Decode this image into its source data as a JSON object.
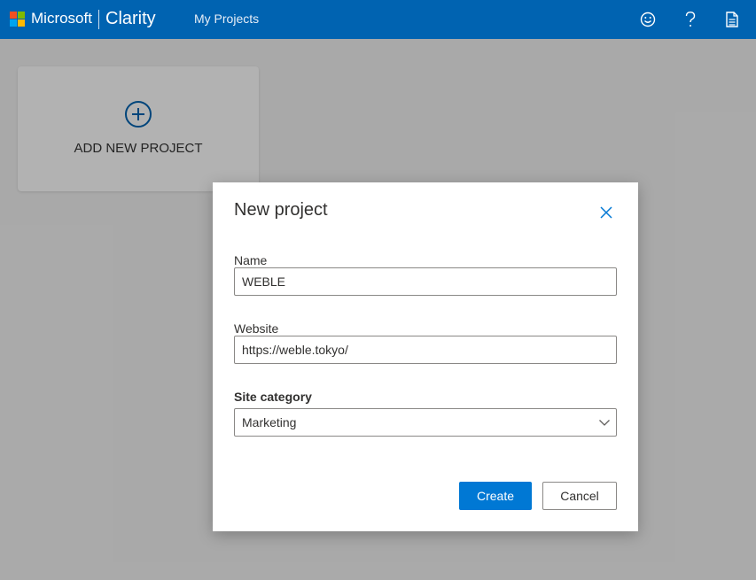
{
  "header": {
    "brand": "Microsoft",
    "product": "Clarity",
    "nav_link": "My Projects",
    "logo_colors": [
      "#f25022",
      "#7fba00",
      "#00a4ef",
      "#ffb900"
    ],
    "icons": [
      "smiley-icon",
      "help-icon",
      "document-icon"
    ]
  },
  "content": {
    "add_project_label": "ADD NEW PROJECT"
  },
  "dialog": {
    "title": "New project",
    "name_label": "Name",
    "name_value": "WEBLE",
    "website_label": "Website",
    "website_value": "https://weble.tokyo/",
    "category_label": "Site category",
    "category_value": "Marketing",
    "create_label": "Create",
    "cancel_label": "Cancel",
    "accent_color": "#0078d4"
  }
}
